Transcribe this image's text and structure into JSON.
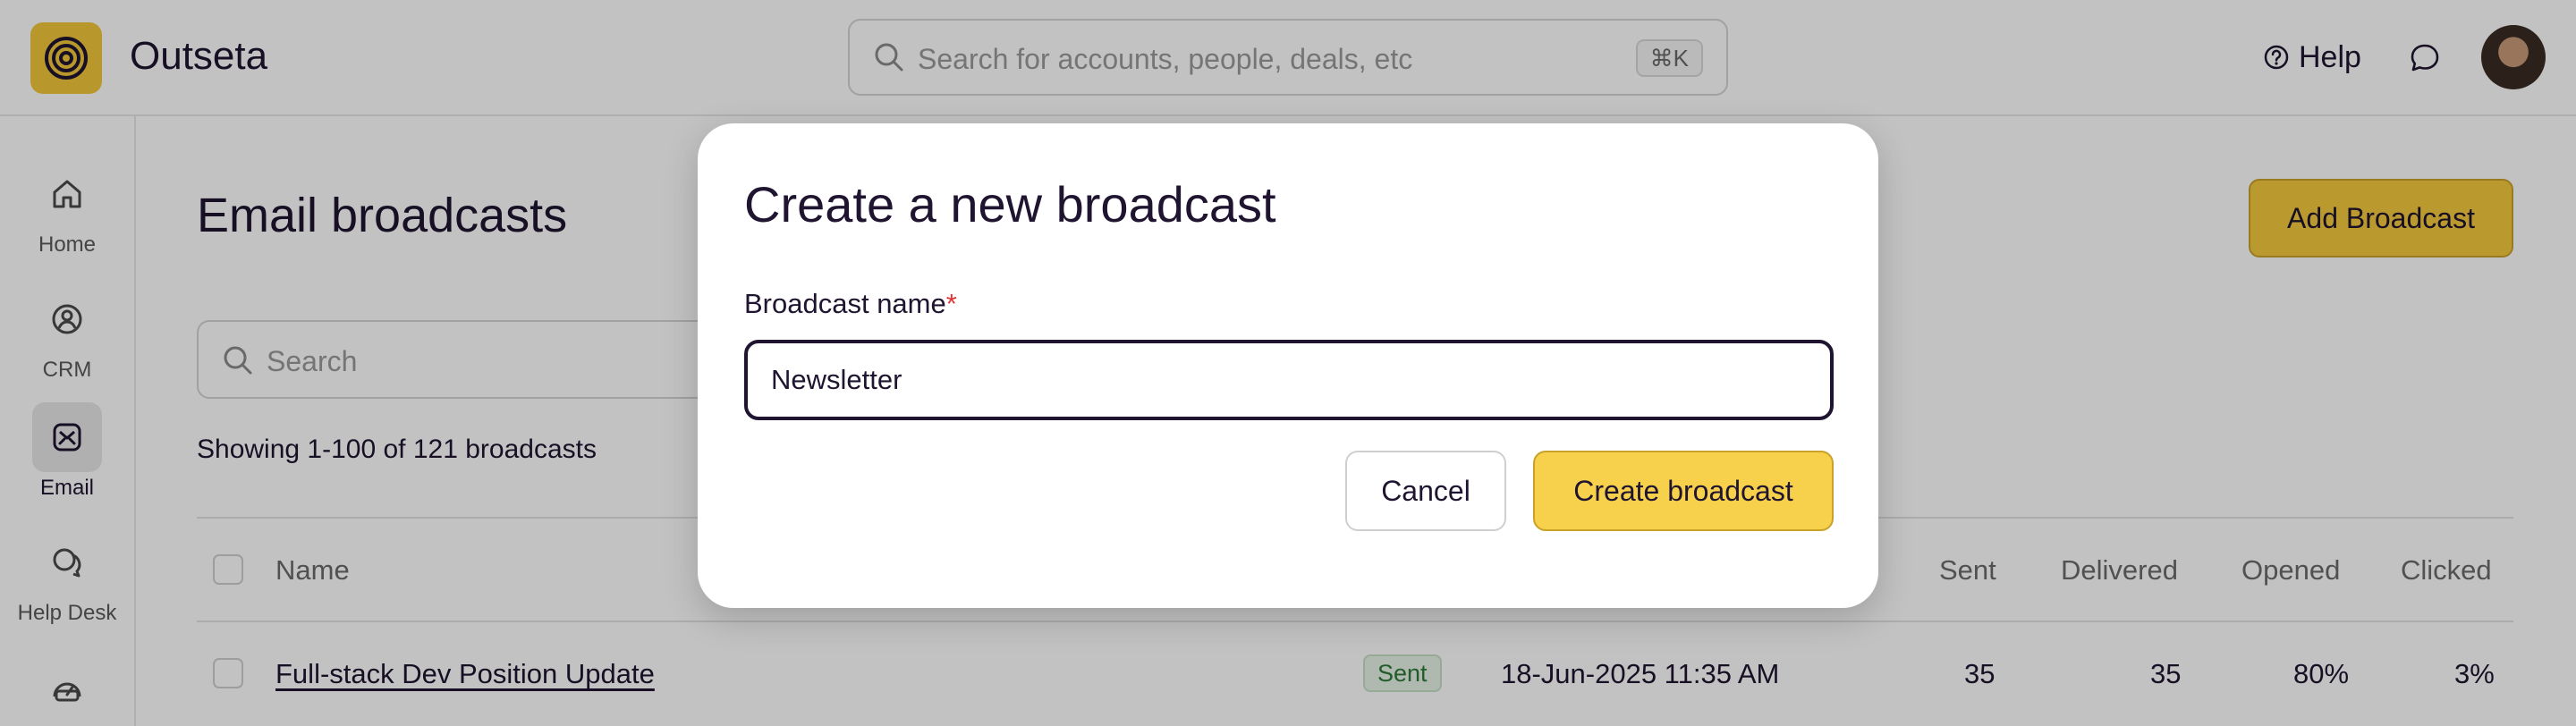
{
  "app": {
    "name": "Outseta",
    "search_placeholder": "Search for accounts, people, deals, etc",
    "search_shortcut": "⌘K",
    "help_label": "Help"
  },
  "sidebar": {
    "items": [
      {
        "label": "Home",
        "icon": "home-icon"
      },
      {
        "label": "CRM",
        "icon": "crm-icon"
      },
      {
        "label": "Email",
        "icon": "email-icon",
        "active": true
      },
      {
        "label": "Help Desk",
        "icon": "help-desk-icon"
      },
      {
        "label": "",
        "icon": "dashboard-icon"
      }
    ]
  },
  "page": {
    "title": "Email broadcasts",
    "add_button": "Add Broadcast",
    "search_placeholder": "Search",
    "showing_text": "Showing 1-100 of 121 broadcasts"
  },
  "table": {
    "columns": [
      "Name",
      "Sent",
      "Delivered",
      "Opened",
      "Clicked"
    ],
    "rows": [
      {
        "name": "Full-stack Dev Position Update",
        "status": "Sent",
        "date": "18-Jun-2025 11:35 AM",
        "sent": "35",
        "delivered": "35",
        "opened": "80%",
        "clicked": "3%"
      }
    ]
  },
  "modal": {
    "title": "Create a new broadcast",
    "field_label": "Broadcast name",
    "required_marker": "*",
    "field_value": "Newsletter",
    "cancel_label": "Cancel",
    "create_label": "Create broadcast"
  },
  "colors": {
    "accent": "#f5ca3e",
    "text": "#1f1530",
    "required": "#e03434",
    "status_sent": "#2d7a37"
  }
}
